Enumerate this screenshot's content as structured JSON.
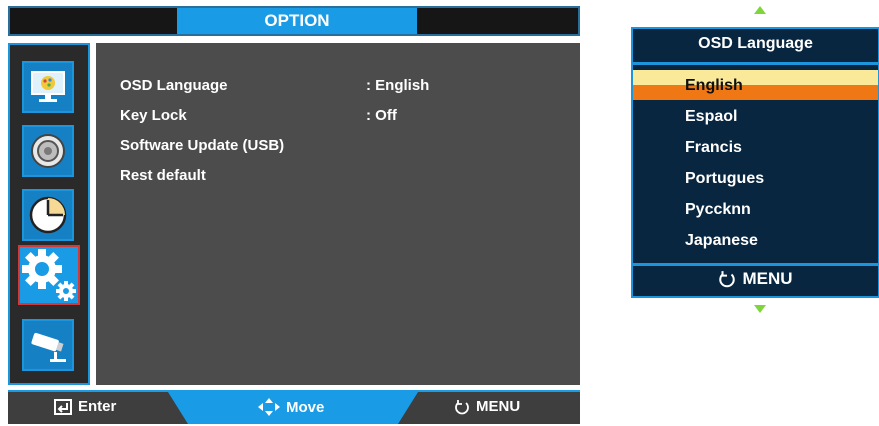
{
  "header": {
    "title": "OPTION"
  },
  "sidebar": {
    "items": [
      {
        "icon": "picture-icon"
      },
      {
        "icon": "audio-speaker-icon"
      },
      {
        "icon": "clock-icon"
      },
      {
        "icon": "settings-gears-icon",
        "selected": true
      },
      {
        "icon": "security-camera-icon"
      }
    ]
  },
  "menu": {
    "items": [
      {
        "label": "OSD Language",
        "value": ": English"
      },
      {
        "label": "Key Lock",
        "value": ": Off"
      },
      {
        "label": "Software Update (USB)",
        "value": ""
      },
      {
        "label": "Rest default",
        "value": ""
      }
    ]
  },
  "footer": {
    "enter_label": "Enter",
    "move_label": "Move",
    "menu_label": "MENU"
  },
  "osd_language_popup": {
    "title": "OSD Language",
    "options": [
      "English",
      "Espaol",
      "Francis",
      "Portugues",
      "Pyccknn",
      "Japanese"
    ],
    "selected": "English",
    "menu_label": "MENU"
  },
  "colors": {
    "accent": "#1a9be6",
    "highlight_top": "#fbe99a",
    "highlight_bottom": "#f07814",
    "scroll_arrow": "#7ed63a",
    "panel_bg": "#082640",
    "main_bg": "#4c4c4c"
  }
}
